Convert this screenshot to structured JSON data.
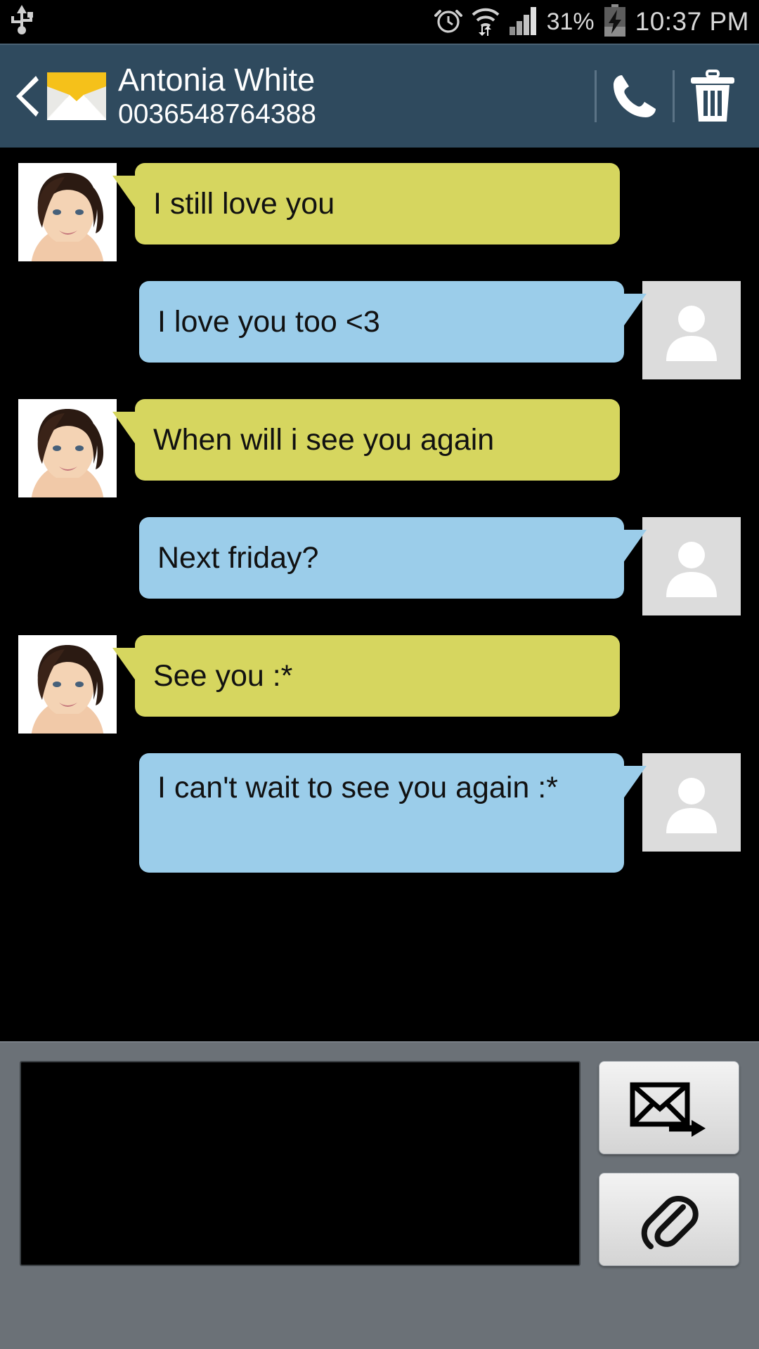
{
  "status_bar": {
    "time": "10:37 PM",
    "battery_percent": "31%",
    "icons": [
      "usb-icon",
      "alarm-icon",
      "wifi-icon",
      "signal-icon",
      "battery-charging-icon"
    ],
    "text_color": "#d8d8d8",
    "background": "#000000"
  },
  "header": {
    "contact_name": "Antonia White",
    "phone_number": "0036548764388",
    "background": "#2f4a5e",
    "back_label": "Back",
    "call_label": "Call",
    "delete_label": "Delete",
    "app_icon": "envelope-icon"
  },
  "conversation": {
    "background": "#000000",
    "incoming_color": "#d6d65f",
    "outgoing_color": "#9bcdea",
    "messages": [
      {
        "text": "I still love you",
        "direction": "in"
      },
      {
        "text": "I love you too <3",
        "direction": "out"
      },
      {
        "text": "When will i see you again",
        "direction": "in"
      },
      {
        "text": "Next friday?",
        "direction": "out"
      },
      {
        "text": "See you :*",
        "direction": "in"
      },
      {
        "text": "I can't wait to see you again :*",
        "direction": "out"
      }
    ]
  },
  "compose": {
    "background": "#6b7177",
    "input_value": "",
    "input_placeholder": "",
    "send_label": "Send",
    "attach_label": "Attach",
    "send_icon": "send-envelope-icon",
    "attach_icon": "paperclip-icon"
  }
}
